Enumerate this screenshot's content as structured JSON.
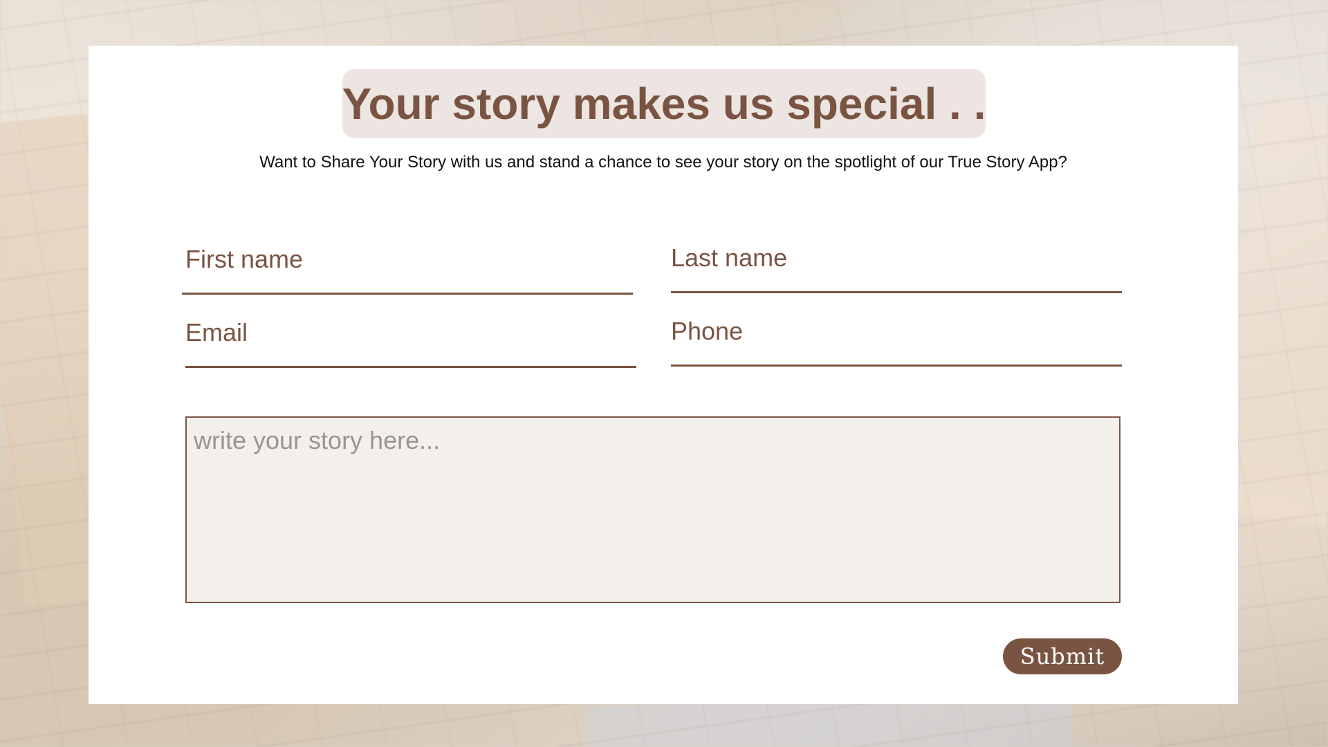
{
  "form": {
    "title": "Your story makes us special . .",
    "subtitle": "Want to Share Your Story with us and stand a chance to see your story on the spotlight of our True Story App?",
    "fields": {
      "first_name": "First name",
      "last_name": "Last name",
      "email": "Email",
      "phone": "Phone"
    },
    "story_placeholder": "write your story here...",
    "submit_label": "Submit"
  },
  "colors": {
    "accent": "#7a5442",
    "title_pill_bg": "#ede5e1",
    "textarea_bg": "#f3f0eb",
    "card_bg": "#ffffff"
  }
}
